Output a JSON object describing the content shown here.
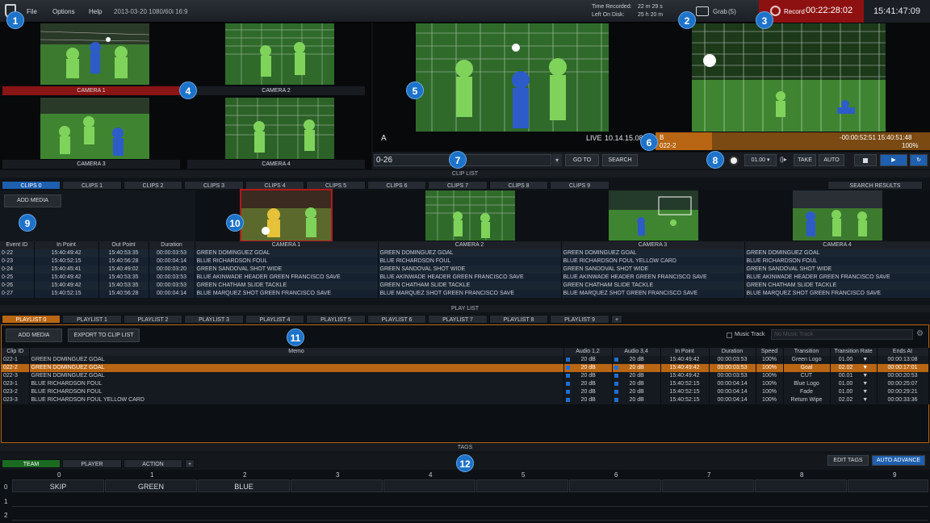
{
  "menu": {
    "file": "File",
    "options": "Options",
    "help": "Help",
    "session": "2013-03-20 1080/60i 16:9"
  },
  "status": {
    "time_recorded_label": "Time Recorded:",
    "time_recorded": "22 m 29 s",
    "left_on_disk_label": "Left On Disk:",
    "left_on_disk": "25 h 20 m",
    "grab_label": "Grab",
    "grab_count": "(5)",
    "record_label": "Record",
    "record_time": "00:22:28:02",
    "clock": "15:41:47:09"
  },
  "cameras": [
    "CAMERA 1",
    "CAMERA 2",
    "CAMERA 3",
    "CAMERA 4"
  ],
  "preview": {
    "a_label": "A",
    "live_label": "LIVE",
    "live_time": "10.14.15.08",
    "b_label": "B",
    "b_clip": "022-2",
    "b_timecode": "-00:00:52:51 15:40:51:48",
    "b_speed": "100%"
  },
  "transport": {
    "search_value": "0-26",
    "goto": "GO TO",
    "search": "SEARCH",
    "rate": "01.00",
    "take": "TAKE",
    "auto": "AUTO"
  },
  "clip_list": {
    "header": "CLIP LIST",
    "tabs": [
      "CLIPS 0",
      "CLIPS 1",
      "CLIPS 2",
      "CLIPS 3",
      "CLIPS 4",
      "CLIPS 5",
      "CLIPS 6",
      "CLIPS 7",
      "CLIPS 8",
      "CLIPS 9"
    ],
    "search_results": "SEARCH RESULTS",
    "add_media": "ADD MEDIA",
    "columns": [
      "Event ID",
      "In Point",
      "Out Point",
      "Duration",
      "CAMERA 1",
      "CAMERA 2",
      "CAMERA 3",
      "CAMERA 4"
    ],
    "rows": [
      [
        "0-22",
        "15:40:49:42",
        "15:40:53:35",
        "00:00:03:53",
        "GREEN DOMINGUEZ GOAL",
        "GREEN DOMINGUEZ GOAL",
        "GREEN DOMINGUEZ GOAL",
        "GREEN DOMINGUEZ GOAL"
      ],
      [
        "0-23",
        "15:40:52:15",
        "15:40:56:28",
        "00:00:04:14",
        "BLUE RICHARDSON FOUL",
        "BLUE RICHARDSON FOUL",
        "BLUE RICHARDSON FOUL YELLOW CARD",
        "BLUE RICHARDSON FOUL"
      ],
      [
        "0-24",
        "15:40:45:41",
        "15:40:49:02",
        "00:00:03:20",
        "GREEN SANDOVAL SHOT WIDE",
        "GREEN SANDOVAL SHOT WIDE",
        "GREEN SANDOVAL SHOT WIDE",
        "GREEN SANDOVAL SHOT WIDE"
      ],
      [
        "0-25",
        "15:40:49:42",
        "15:40:53:35",
        "00:00:03:53",
        "BLUE AKINWADE HEADER GREEN FRANCISCO SAVE",
        "BLUE AKINWADE HEADER GREEN FRANCISCO SAVE",
        "BLUE AKINWADE HEADER GREEN FRANCISCO SAVE",
        "BLUE AKINWADE HEADER GREEN FRANCISCO SAVE"
      ],
      [
        "0-26",
        "15:40:49:42",
        "15:40:53:35",
        "00:00:03:53",
        "GREEN CHATHAM SLIDE TACKLE",
        "GREEN CHATHAM SLIDE TACKLE",
        "GREEN CHATHAM SLIDE TACKLE",
        "GREEN CHATHAM SLIDE TACKLE"
      ],
      [
        "0-27",
        "15:40:52:15",
        "15:40:56:28",
        "00:00:04:14",
        "BLUE MARQUEZ SHOT GREEN FRANCISCO SAVE",
        "BLUE MARQUEZ SHOT GREEN FRANCISCO SAVE",
        "BLUE MARQUEZ SHOT GREEN FRANCISCO SAVE",
        "BLUE MARQUEZ SHOT GREEN FRANCISCO SAVE"
      ]
    ]
  },
  "play_list": {
    "header": "PLAY LIST",
    "tabs": [
      "PLAYLIST 0",
      "PLAYLIST 1",
      "PLAYLIST 2",
      "PLAYLIST 3",
      "PLAYLIST 4",
      "PLAYLIST 5",
      "PLAYLIST 6",
      "PLAYLIST 7",
      "PLAYLIST 8",
      "PLAYLIST 9"
    ],
    "add_tab": "+",
    "add_media": "ADD MEDIA",
    "export": "EXPORT TO CLIP LIST",
    "music_track_label": "Music Track",
    "music_track_placeholder": "No Music Track",
    "columns": [
      "Clip ID",
      "Memo",
      "Audio 1,2",
      "Audio 3,4",
      "In Point",
      "Duration",
      "Speed",
      "Transition",
      "Transition Rate",
      "Ends At"
    ],
    "rows": [
      [
        "022-1",
        "GREEN DOMINGUEZ GOAL",
        "20 dB",
        "20 dB",
        "15:40:49:42",
        "00:00:03:53",
        "100%",
        "Green Logo",
        "01.00",
        "00:00:13:08"
      ],
      [
        "022-2",
        "GREEN DOMINGUEZ GOAL",
        "20 dB",
        "20 dB",
        "15:40:49:42",
        "00:00:03:53",
        "100%",
        "Goal",
        "02.02",
        "00:00:17:01"
      ],
      [
        "022-3",
        "GREEN DOMINGUEZ GOAL",
        "20 dB",
        "20 dB",
        "15:40:49:42",
        "00:00:03:53",
        "100%",
        "CUT",
        "00.01",
        "00:00:20:53"
      ],
      [
        "023-1",
        "BLUE RICHARDSON FOUL",
        "20 dB",
        "20 dB",
        "15:40:52:15",
        "00:00:04:14",
        "100%",
        "Blue Logo",
        "01.00",
        "00:00:25:07"
      ],
      [
        "023-2",
        "BLUE RICHARDSON FOUL",
        "20 dB",
        "20 dB",
        "15:40:52:15",
        "00:00:04:14",
        "100%",
        "Fade",
        "01.00",
        "00:00:29:21"
      ],
      [
        "023-3",
        "BLUE RICHARDSON FOUL YELLOW CARD",
        "20 dB",
        "20 dB",
        "15:40:52:15",
        "00:00:04:14",
        "100%",
        "Return Wipe",
        "02.02",
        "00:00:33:36"
      ]
    ],
    "highlight_row": 1
  },
  "tags": {
    "header": "TAGS",
    "tabs": [
      "TEAM",
      "PLAYER",
      "ACTION"
    ],
    "add_tab": "+",
    "edit_tags": "EDIT TAGS",
    "auto_advance": "AUTO ADVANCE",
    "col_numbers": [
      "0",
      "1",
      "2",
      "3",
      "4",
      "5",
      "6",
      "7",
      "8",
      "9"
    ],
    "row_numbers": [
      "0",
      "1",
      "2"
    ],
    "row0": [
      "SKIP",
      "GREEN",
      "BLUE"
    ]
  },
  "callouts": [
    "1",
    "2",
    "3",
    "4",
    "5",
    "6",
    "7",
    "8",
    "9",
    "10",
    "11",
    "12"
  ],
  "colors": {
    "accent_blue": "#1e5fae",
    "accent_orange": "#b86613",
    "record_red": "#8e1111",
    "tag_green": "#1b6a22"
  }
}
